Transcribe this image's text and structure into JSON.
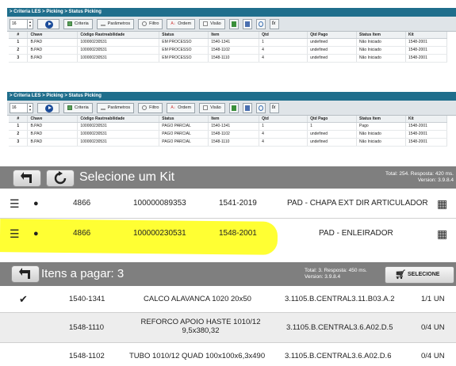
{
  "panels": [
    {
      "title": "> Criteria LES > Picking > Status Picking",
      "page_size": "16",
      "toolbar": {
        "criteria": "Criteria",
        "parametros": "Parâmetros",
        "filtro": "Filtro",
        "ordem": "Ordem",
        "visao": "Visão"
      },
      "columns": [
        "#",
        "Chave",
        "Código Rastreabilidade",
        "Status",
        "Item",
        "Qtd",
        "Qtd Pago",
        "Status Item",
        "Kit"
      ],
      "rows": [
        [
          "1",
          "B.PAD",
          "100000230531",
          "EM PROCESSO",
          "1540-1341",
          "1",
          "undefined",
          "Não Iniciado",
          "1548-2001"
        ],
        [
          "2",
          "B.PAD",
          "100000230531",
          "EM PROCESSO",
          "1548-1102",
          "4",
          "undefined",
          "Não Iniciado",
          "1548-2001"
        ],
        [
          "3",
          "B.PAD",
          "100000230531",
          "EM PROCESSO",
          "1548-1110",
          "4",
          "undefined",
          "Não Iniciado",
          "1548-2001"
        ]
      ]
    },
    {
      "title": "> Criteria LES > Picking > Status Picking",
      "page_size": "16",
      "toolbar": {
        "criteria": "Criteria",
        "parametros": "Parâmetros",
        "filtro": "Filtro",
        "ordem": "Ordem",
        "visao": "Visão"
      },
      "columns": [
        "#",
        "Chave",
        "Código Rastreabilidade",
        "Status",
        "Item",
        "Qtd",
        "Qtd Pago",
        "Status Item",
        "Kit"
      ],
      "rows": [
        [
          "1",
          "B.PAD",
          "100000230531",
          "PAGO PARCIAL",
          "1540-1341",
          "1",
          "1",
          "Pago",
          "1548-2001"
        ],
        [
          "2",
          "B.PAD",
          "100000230531",
          "PAGO PARCIAL",
          "1548-1102",
          "4",
          "undefined",
          "Não Iniciado",
          "1548-2001"
        ],
        [
          "3",
          "B.PAD",
          "100000230531",
          "PAGO PARCIAL",
          "1548-1110",
          "4",
          "undefined",
          "Não Iniciado",
          "1548-2001"
        ]
      ]
    }
  ],
  "kit_panel": {
    "title": "Selecione um Kit",
    "info_line1": "Total: 254. Resposta: 420 ms.",
    "info_line2": "Version: 3.9.8.4",
    "rows": [
      {
        "code": "4866",
        "tracking": "100000089353",
        "kit": "1541-2019",
        "description": "PAD - CHAPA EXT DIR ARTICULADOR",
        "highlighted": false
      },
      {
        "code": "4866",
        "tracking": "100000230531",
        "kit": "1548-2001",
        "description": "PAD - ENLEIRADOR",
        "highlighted": true
      }
    ]
  },
  "itens_panel": {
    "title": "Itens a pagar: 3",
    "info_line1": "Total: 3. Resposta: 450 ms.",
    "info_line2": "Version: 3.9.8.4",
    "select_label": "SELECIONE",
    "rows": [
      {
        "done": true,
        "item": "1540-1341",
        "description": "CALCO ALAVANCA 1020 20x50",
        "location": "3.1105.B.CENTRAL3.11.B03.A.2",
        "qty": "1/1 UN"
      },
      {
        "done": false,
        "item": "1548-1110",
        "description": "REFORCO APOIO HASTE 1010/12 9,5x380,32",
        "location": "3.1105.B.CENTRAL3.6.A02.D.5",
        "qty": "0/4 UN"
      },
      {
        "done": false,
        "item": "1548-1102",
        "description": "TUBO 1010/12 QUAD 100x100x6,3x490",
        "location": "3.1105.B.CENTRAL3.6.A02.D.6",
        "qty": "0/4 UN"
      }
    ]
  },
  "colors": {
    "title_bar": "#1f6e8c",
    "header_gray": "#7f7f7f",
    "highlight": "#ffff33"
  }
}
